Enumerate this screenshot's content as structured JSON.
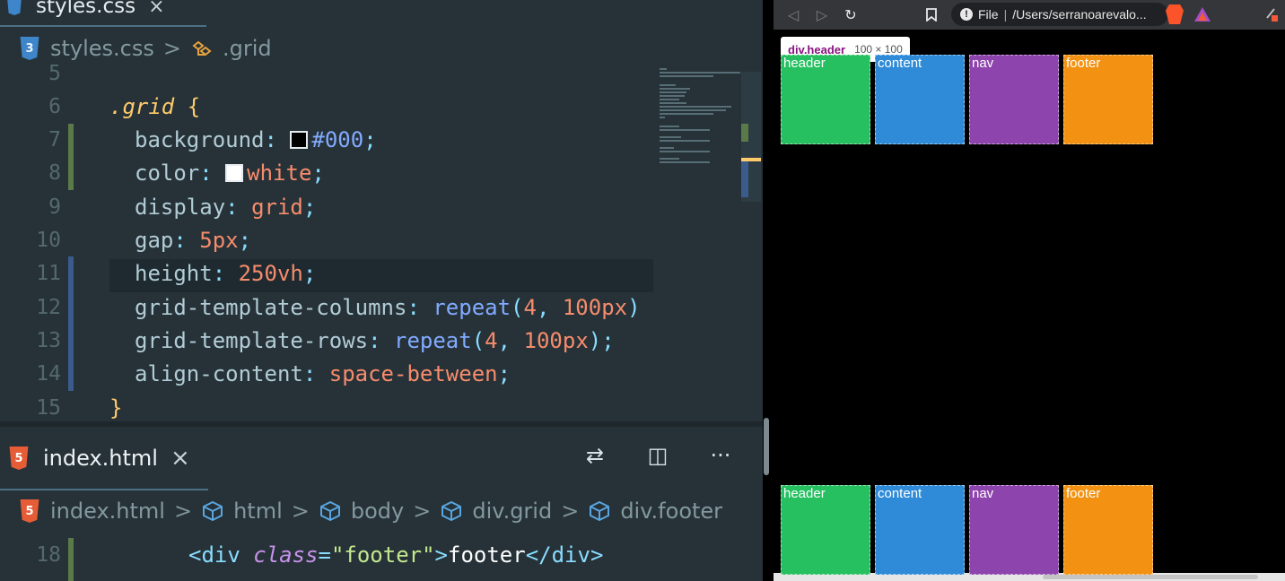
{
  "editor": {
    "top_tab": {
      "label": "styles.css",
      "close": "×"
    },
    "css_breadcrumb": {
      "file": "styles.css",
      "sep": ">",
      "symbol": ".grid",
      "badge": "3"
    },
    "css_code": [
      {
        "ln": "5",
        "parts": []
      },
      {
        "ln": "6",
        "parts": [
          {
            "t": ".grid ",
            "c": "c-sel"
          },
          {
            "t": "{",
            "c": "c-brace"
          }
        ]
      },
      {
        "ln": "7",
        "parts": [
          {
            "t": "background",
            "c": "c-prop"
          },
          {
            "t": ": ",
            "c": "c-punc"
          },
          {
            "t": "#000",
            "c": "c-fn",
            "swatch": "#000000"
          },
          {
            "t": ";",
            "c": "c-punc"
          }
        ]
      },
      {
        "ln": "8",
        "parts": [
          {
            "t": "color",
            "c": "c-prop"
          },
          {
            "t": ": ",
            "c": "c-punc"
          },
          {
            "t": "white",
            "c": "c-val",
            "swatch": "#ffffff"
          },
          {
            "t": ";",
            "c": "c-punc"
          }
        ]
      },
      {
        "ln": "9",
        "parts": [
          {
            "t": "display",
            "c": "c-prop"
          },
          {
            "t": ": ",
            "c": "c-punc"
          },
          {
            "t": "grid",
            "c": "c-val"
          },
          {
            "t": ";",
            "c": "c-punc"
          }
        ]
      },
      {
        "ln": "10",
        "parts": [
          {
            "t": "gap",
            "c": "c-prop"
          },
          {
            "t": ": ",
            "c": "c-punc"
          },
          {
            "t": "5px",
            "c": "c-val"
          },
          {
            "t": ";",
            "c": "c-punc"
          }
        ]
      },
      {
        "ln": "11",
        "parts": [
          {
            "t": "height",
            "c": "c-prop"
          },
          {
            "t": ": ",
            "c": "c-punc"
          },
          {
            "t": "250vh",
            "c": "c-val"
          },
          {
            "t": ";",
            "c": "c-punc"
          }
        ]
      },
      {
        "ln": "12",
        "parts": [
          {
            "t": "grid-template-columns",
            "c": "c-prop"
          },
          {
            "t": ": ",
            "c": "c-punc"
          },
          {
            "t": "repeat",
            "c": "c-fn"
          },
          {
            "t": "(",
            "c": "c-punc"
          },
          {
            "t": "4",
            "c": "c-val"
          },
          {
            "t": ", ",
            "c": "c-punc"
          },
          {
            "t": "100px",
            "c": "c-val"
          },
          {
            "t": ")",
            "c": "c-punc"
          }
        ]
      },
      {
        "ln": "13",
        "parts": [
          {
            "t": "grid-template-rows",
            "c": "c-prop"
          },
          {
            "t": ": ",
            "c": "c-punc"
          },
          {
            "t": "repeat",
            "c": "c-fn"
          },
          {
            "t": "(",
            "c": "c-punc"
          },
          {
            "t": "4",
            "c": "c-val"
          },
          {
            "t": ", ",
            "c": "c-punc"
          },
          {
            "t": "100px",
            "c": "c-val"
          },
          {
            "t": ");",
            "c": "c-punc"
          }
        ]
      },
      {
        "ln": "14",
        "parts": [
          {
            "t": "align-content",
            "c": "c-prop"
          },
          {
            "t": ": ",
            "c": "c-punc"
          },
          {
            "t": "space-between",
            "c": "c-val"
          },
          {
            "t": ";",
            "c": "c-punc"
          }
        ]
      },
      {
        "ln": "15",
        "parts": [
          {
            "t": "}",
            "c": "c-brace"
          }
        ]
      }
    ],
    "bottom_tab": {
      "label": "index.html",
      "close": "×",
      "badge": "5"
    },
    "html_breadcrumb": [
      "index.html",
      "html",
      "body",
      "div.grid",
      "div.footer"
    ],
    "html_code": [
      {
        "ln": "18",
        "parts": [
          {
            "t": "<div ",
            "c": "c-tag"
          },
          {
            "t": "class",
            "c": "c-attr"
          },
          {
            "t": "=",
            "c": "c-punc"
          },
          {
            "t": "\"footer\"",
            "c": "c-str"
          },
          {
            "t": ">",
            "c": "c-tag"
          },
          {
            "t": "footer",
            "c": "c-white"
          },
          {
            "t": "</div>",
            "c": "c-tag"
          }
        ]
      }
    ],
    "actions": {
      "compare": "⇄",
      "split": "◫",
      "more": "···"
    }
  },
  "browser": {
    "nav": {
      "back": "◁",
      "forward": "▷",
      "reload": "↻",
      "bookmark": "🔖"
    },
    "url": {
      "scheme": "File",
      "sep": "|",
      "path": "/Users/serranoarevalo..."
    },
    "tooltip": {
      "name": "div.header",
      "size": "100 × 100"
    },
    "cells_top": [
      {
        "label": "header",
        "color": "#27c060"
      },
      {
        "label": "content",
        "color": "#2f8bd8"
      },
      {
        "label": "nav",
        "color": "#8e44ad"
      },
      {
        "label": "footer",
        "color": "#f39212"
      }
    ],
    "cells_bottom": [
      {
        "label": "header",
        "color": "#27c060"
      },
      {
        "label": "content",
        "color": "#2f8bd8"
      },
      {
        "label": "nav",
        "color": "#8e44ad"
      },
      {
        "label": "footer",
        "color": "#f39212"
      }
    ]
  }
}
